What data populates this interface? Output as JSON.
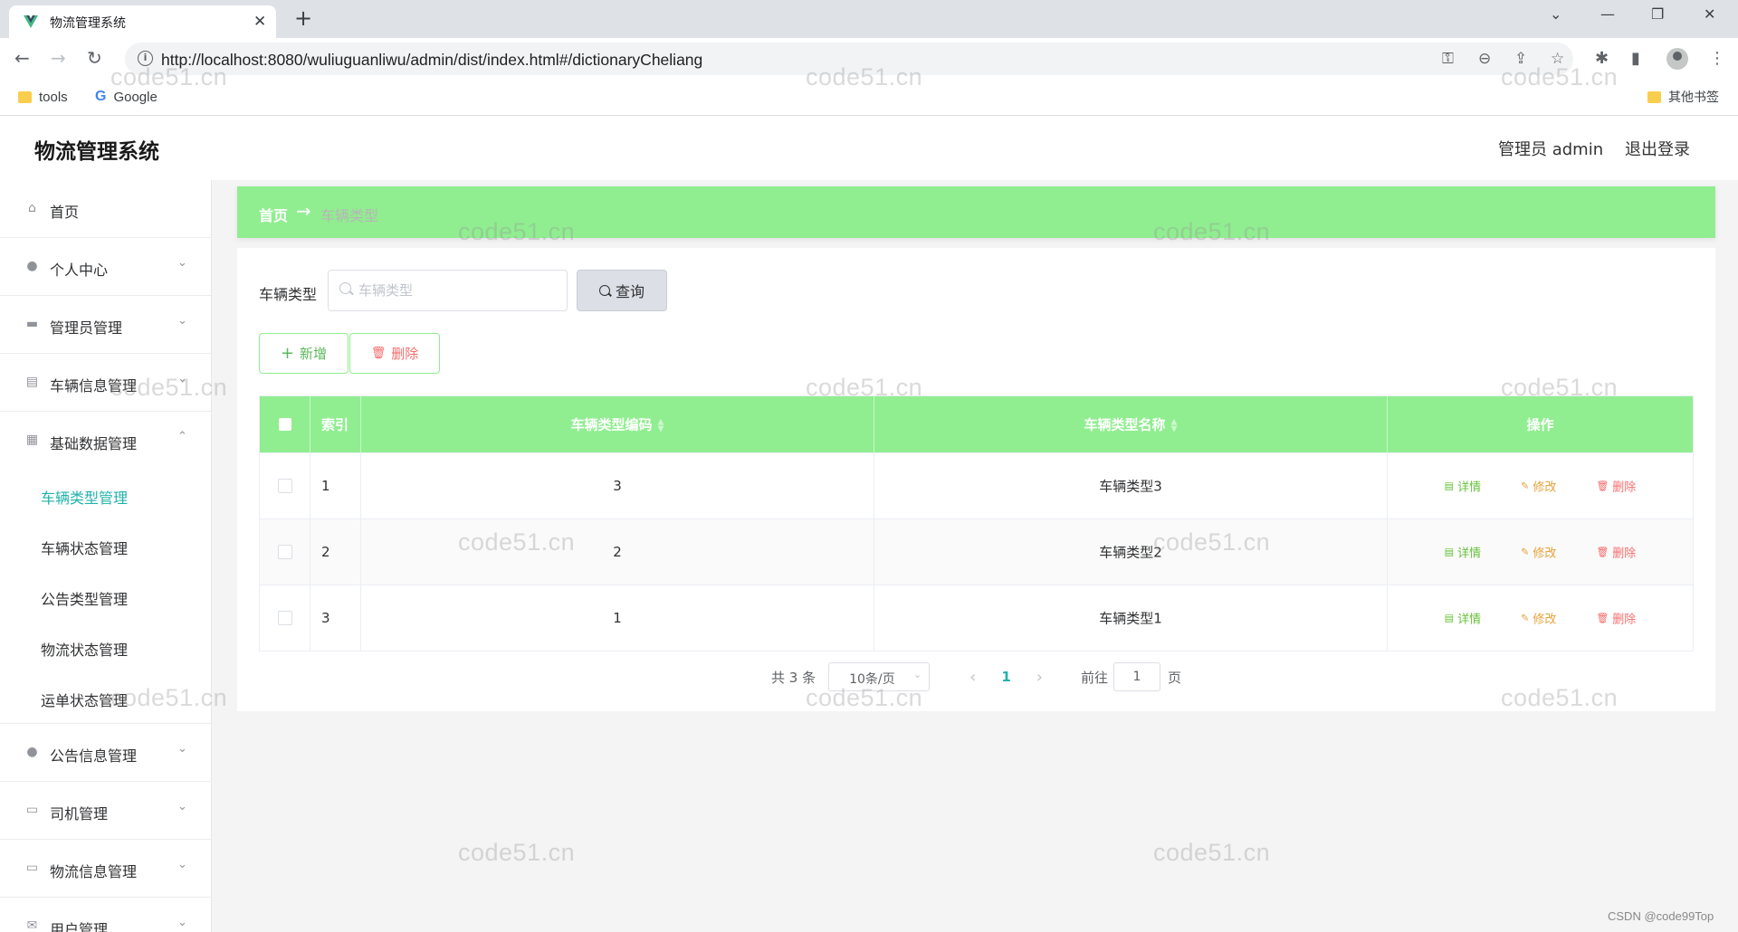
{
  "browser": {
    "tab_title": "物流管理系统",
    "url": "http://localhost:8080/wuliuguanliwu/admin/dist/index.html#/dictionaryCheliang",
    "bookmarks": [
      {
        "label": "tools",
        "icon": "folder-icon"
      },
      {
        "label": "Google",
        "icon": "google-icon"
      }
    ],
    "other_bookmarks": "其他书签"
  },
  "header": {
    "title": "物流管理系统",
    "admin": "管理员 admin",
    "logout": "退出登录"
  },
  "sidebar": {
    "items": [
      {
        "label": "首页",
        "icon": "home-icon"
      },
      {
        "label": "个人中心",
        "icon": "user-icon"
      },
      {
        "label": "管理员管理",
        "icon": "chat-icon"
      },
      {
        "label": "车辆信息管理",
        "icon": "clipboard-icon"
      },
      {
        "label": "基础数据管理",
        "icon": "grid-icon"
      },
      {
        "label": "公告信息管理",
        "icon": "pin-icon"
      },
      {
        "label": "司机管理",
        "icon": "monitor-icon"
      },
      {
        "label": "物流信息管理",
        "icon": "message-icon"
      },
      {
        "label": "用户管理",
        "icon": "mail-icon"
      }
    ],
    "submenu": [
      {
        "label": "车辆类型管理"
      },
      {
        "label": "车辆状态管理"
      },
      {
        "label": "公告类型管理"
      },
      {
        "label": "物流状态管理"
      },
      {
        "label": "运单状态管理"
      }
    ]
  },
  "breadcrumb": {
    "home": "首页",
    "arrow": "→",
    "current": "车辆类型"
  },
  "search": {
    "label": "车辆类型",
    "placeholder": "车辆类型",
    "button": "查询"
  },
  "actions": {
    "add": "新增",
    "delete": "删除"
  },
  "table": {
    "headers": {
      "index": "索引",
      "code": "车辆类型编码",
      "name": "车辆类型名称",
      "ops": "操作"
    },
    "rows": [
      {
        "index": "1",
        "code": "3",
        "name": "车辆类型3"
      },
      {
        "index": "2",
        "code": "2",
        "name": "车辆类型2"
      },
      {
        "index": "3",
        "code": "1",
        "name": "车辆类型1"
      }
    ],
    "op_labels": {
      "detail": "详情",
      "edit": "修改",
      "delete": "删除"
    }
  },
  "pager": {
    "total": "共 3 条",
    "page_size": "10条/页",
    "current_page": "1",
    "goto_label": "前往",
    "goto_value": "1",
    "page_unit": "页"
  },
  "watermark": "code51.cn",
  "credit": "CSDN @code99Top",
  "colors": {
    "accent": "#90ee90",
    "active_menu": "#20b2aa",
    "danger": "#f56c6c",
    "warning": "#e6a23c",
    "success": "#67c23a"
  }
}
